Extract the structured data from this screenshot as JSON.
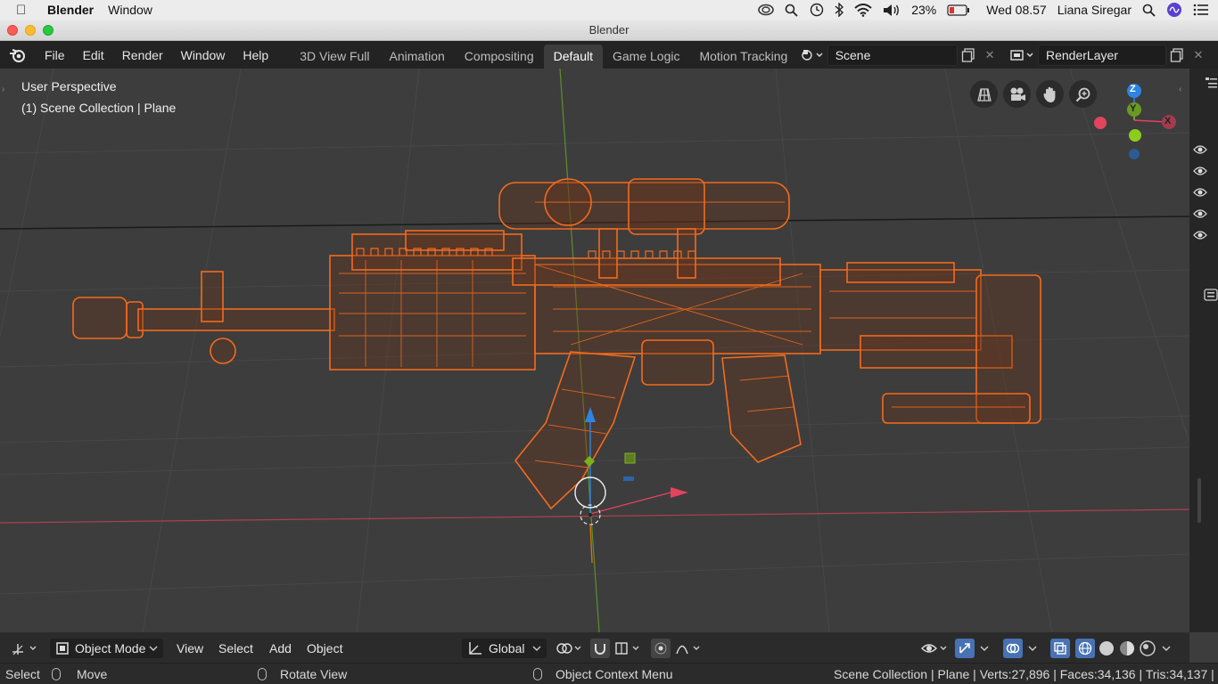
{
  "mac_menubar": {
    "app_name": "Blender",
    "menu": "Window",
    "battery": "23%",
    "clock": "Wed 08.57",
    "user": "Liana Siregar"
  },
  "window": {
    "title": "Blender"
  },
  "topbar": {
    "menus": [
      "File",
      "Edit",
      "Render",
      "Window",
      "Help"
    ],
    "tabs": [
      "3D View Full",
      "Animation",
      "Compositing",
      "Default",
      "Game Logic",
      "Motion Tracking"
    ],
    "active_tab": "Default",
    "scene": "Scene",
    "render_layer": "RenderLayer"
  },
  "viewport": {
    "perspective": "User Perspective",
    "collection": "(1) Scene Collection | Plane",
    "gizmo_axes": {
      "x": "X",
      "y": "Y",
      "z": "Z"
    },
    "colors": {
      "x": "#e2445c",
      "y": "#7ab317",
      "z": "#2f84e3",
      "wire": "#f26b1d"
    }
  },
  "header": {
    "mode": "Object Mode",
    "menus": [
      "View",
      "Select",
      "Add",
      "Object"
    ],
    "orientation": "Global"
  },
  "status": {
    "select": "Select",
    "move": "Move",
    "rotate": "Rotate View",
    "context": "Object Context Menu",
    "stats": "Scene Collection | Plane | Verts:27,896 | Faces:34,136 | Tris:34,137 |"
  }
}
